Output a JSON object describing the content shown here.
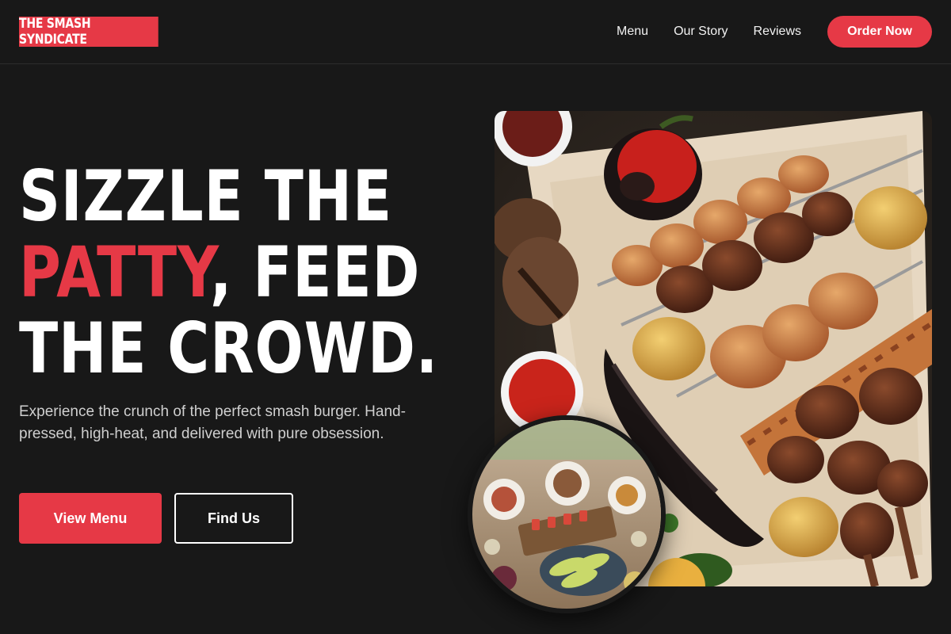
{
  "brand": {
    "name": "THE SMASH SYNDICATE"
  },
  "nav": {
    "links": [
      "Menu",
      "Our Story",
      "Reviews"
    ],
    "cta": "Order Now"
  },
  "hero": {
    "headline": {
      "line1": "SIZZLE THE",
      "line2_highlight": "PATTY",
      "line2_rest": ", FEED",
      "line3": "THE CROWD."
    },
    "subtext": "Experience the crunch of the perfect smash burger. Hand-pressed, high-heat, and delivered with pure obsession.",
    "primary_button": "View Menu",
    "secondary_button": "Find Us"
  },
  "images": {
    "main": "grilled-meat-platter-photo",
    "inset": "dining-table-spread-photo"
  },
  "colors": {
    "background": "#181818",
    "accent": "#e63946",
    "text": "#ffffff",
    "muted": "#cfcfcf"
  }
}
